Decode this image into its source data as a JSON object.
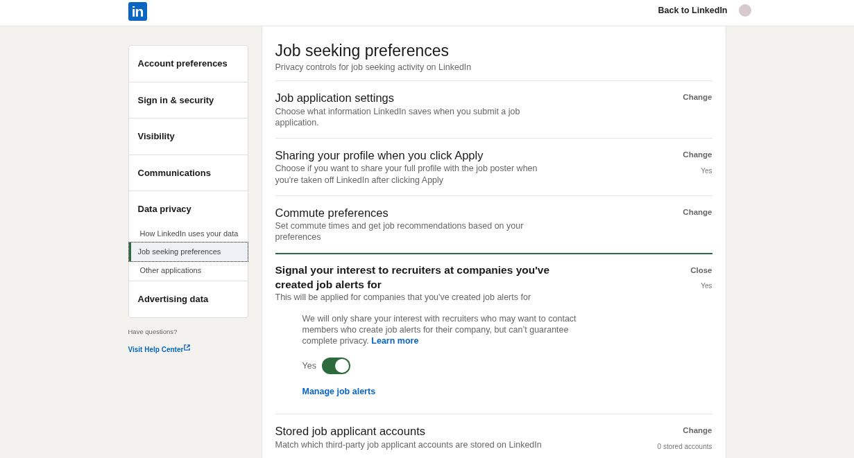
{
  "header": {
    "logo": "in",
    "back_link": "Back to LinkedIn"
  },
  "sidebar": {
    "items": [
      {
        "label": "Account preferences",
        "selected": false
      },
      {
        "label": "Sign in & security",
        "selected": false
      },
      {
        "label": "Visibility",
        "selected": false
      },
      {
        "label": "Communications",
        "selected": false
      },
      {
        "label": "Data privacy",
        "selected": false,
        "children": [
          {
            "label": "How LinkedIn uses your data",
            "selected": false
          },
          {
            "label": "Job seeking preferences",
            "selected": true
          },
          {
            "label": "Other applications",
            "selected": false
          }
        ]
      },
      {
        "label": "Advertising data",
        "selected": false
      }
    ],
    "help_question": "Have questions?",
    "help_link": "Visit Help Center"
  },
  "page": {
    "title": "Job seeking preferences",
    "subtitle": "Privacy controls for job seeking activity on LinkedIn"
  },
  "sections": [
    {
      "title": "Job application settings",
      "description": "Choose what information LinkedIn saves when you submit a job application.",
      "action": "Change",
      "expanded": false
    },
    {
      "title": "Sharing your profile when you click Apply",
      "description": "Choose if you want to share your full profile with the job poster when you're taken off LinkedIn after clicking Apply",
      "action": "Change",
      "value": "Yes",
      "expanded": false
    },
    {
      "title": "Commute preferences",
      "description": "Set commute times and get job recommendations based on your preferences",
      "action": "Change",
      "expanded": false
    },
    {
      "title": "Signal your interest to recruiters at companies you've created job alerts for",
      "description": "This will be applied for companies that you've created job alerts for",
      "action": "Close",
      "value": "Yes",
      "expanded": true,
      "detail": "We will only share your interest with recruiters who may want to contact members who create job alerts for their company, but can’t guarantee complete privacy.",
      "detail_link": "Learn more",
      "toggle": {
        "label": "Yes",
        "on": true
      },
      "link": "Manage job alerts"
    },
    {
      "title": "Stored job applicant accounts",
      "description": "Match which third-party job applicant accounts are stored on LinkedIn",
      "action": "Change",
      "value": "0 stored accounts",
      "expanded": false
    }
  ]
}
